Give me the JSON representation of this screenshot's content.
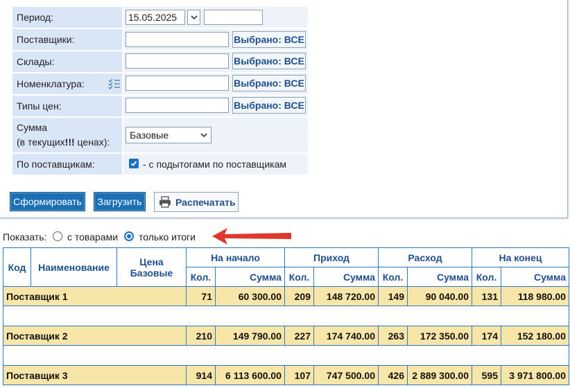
{
  "filters": {
    "period_label": "Период:",
    "period_from": "15.05.2025",
    "period_to": "",
    "suppliers_label": "Поставщики:",
    "warehouses_label": "Склады:",
    "nomenclature_label": "Номенклатура:",
    "price_types_label": "Типы цен:",
    "selected_all": "Выбрано: ВСЕ",
    "sum_label_line1": "Сумма",
    "sum_label_line2_a": "(в текущих",
    "sum_label_line2_b": "!!!",
    "sum_label_line2_c": " ценах):",
    "sum_select_value": "Базовые",
    "by_supplier_label": "По поставщикам:",
    "by_supplier_checkbox": "- с подытогами по поставщикам",
    "by_supplier_checked": true
  },
  "buttons": {
    "form": "Сформировать",
    "load": "Загрузить",
    "print": "Распечатать"
  },
  "show": {
    "label": "Показать:",
    "opt_goods": "с товарами",
    "opt_totals": "только итоги",
    "selected": "opt_totals"
  },
  "table": {
    "headers": {
      "code": "Код",
      "name": "Наименование",
      "price_line1": "Цена",
      "price_line2": "Базовые",
      "start": "На начало",
      "income": "Приход",
      "expense": "Расход",
      "end": "На конец",
      "qty": "Кол.",
      "sum": "Сумма"
    },
    "rows": [
      {
        "name": "Поставщик 1",
        "start_qty": "71",
        "start_sum": "60 300.00",
        "in_qty": "209",
        "in_sum": "148 720.00",
        "out_qty": "149",
        "out_sum": "90 040.00",
        "end_qty": "131",
        "end_sum": "118 980.00"
      },
      {
        "name": "Поставщик 2",
        "start_qty": "210",
        "start_sum": "149 790.00",
        "in_qty": "227",
        "in_sum": "174 740.00",
        "out_qty": "263",
        "out_sum": "172 350.00",
        "end_qty": "174",
        "end_sum": "152 180.00"
      },
      {
        "name": "Поставщик 3",
        "start_qty": "914",
        "start_sum": "6 113 600.00",
        "in_qty": "107",
        "in_sum": "747 500.00",
        "out_qty": "426",
        "out_sum": "2 889 300.00",
        "end_qty": "595",
        "end_sum": "3 971 800.00"
      }
    ]
  },
  "colors": {
    "label_bg": "#d9e6f7",
    "accent": "#1a6fb5",
    "supplier_row": "#f7e6a8",
    "arrow": "#e0382f"
  }
}
